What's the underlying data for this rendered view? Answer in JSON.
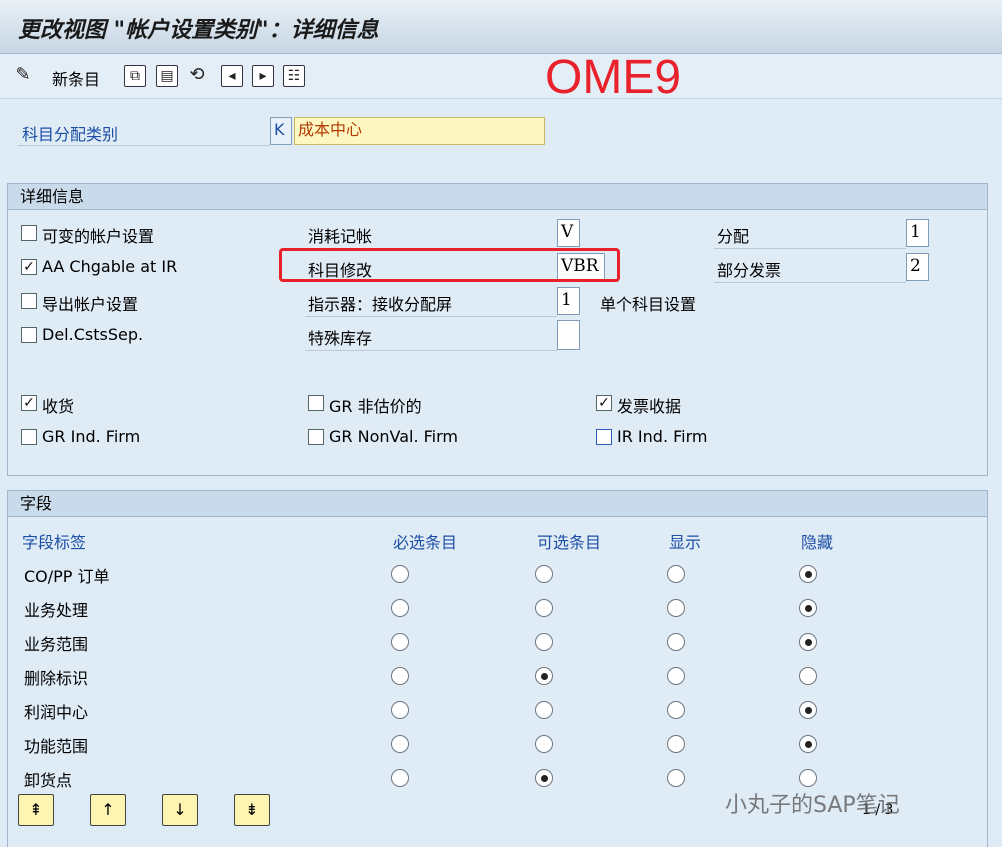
{
  "window": {
    "title": "更改视图 \"帐户设置类别\"：详细信息"
  },
  "toolbar": {
    "new_entries_label": "新条目",
    "icons": [
      "edit-icon",
      "copy-icon",
      "delete-icon",
      "undo-icon",
      "prev-icon",
      "next-icon",
      "select-icon"
    ]
  },
  "annotation": {
    "tcode": "OME9",
    "color": "#e8212a"
  },
  "header": {
    "acct_cat_label": "科目分配类别",
    "acct_cat_code": "K",
    "acct_cat_text": "成本中心"
  },
  "details": {
    "title": "详细信息",
    "left_checks": [
      {
        "label": "可变的帐户设置",
        "checked": false
      },
      {
        "label": "AA Chgable at IR",
        "checked": true
      },
      {
        "label": "导出帐户设置",
        "checked": false
      },
      {
        "label": "Del.CstsSep.",
        "checked": false
      }
    ],
    "mid_fields": [
      {
        "label": "消耗记帐",
        "value": "V"
      },
      {
        "label": "科目修改",
        "value": "VBR"
      },
      {
        "label": "指示器：接收分配屏",
        "value": "1",
        "suffix": "单个科目设置"
      },
      {
        "label": "特殊库存",
        "value": ""
      }
    ],
    "right_fields": [
      {
        "label": "分配",
        "value": "1"
      },
      {
        "label": "部分发票",
        "value": "2"
      }
    ],
    "bottom_checks": [
      {
        "label": "收货",
        "checked": true
      },
      {
        "label": "GR 非估价的",
        "checked": false
      },
      {
        "label": "发票收据",
        "checked": true
      },
      {
        "label": "GR Ind. Firm",
        "checked": false
      },
      {
        "label": "GR NonVal. Firm",
        "checked": false
      },
      {
        "label": "IR Ind. Firm",
        "checked": false
      }
    ]
  },
  "fields_section": {
    "title": "字段",
    "columns": [
      "字段标签",
      "必选条目",
      "可选条目",
      "显示",
      "隐藏"
    ],
    "rows": [
      {
        "label": "CO/PP 订单",
        "selected": 3
      },
      {
        "label": "业务处理",
        "selected": 3
      },
      {
        "label": "业务范围",
        "selected": 3
      },
      {
        "label": "删除标识",
        "selected": 1
      },
      {
        "label": "利润中心",
        "selected": 3
      },
      {
        "label": "功能范围",
        "selected": 3
      },
      {
        "label": "卸货点",
        "selected": 1
      }
    ],
    "page_info": "1 / 3"
  },
  "watermark": "小丸子的SAP笔记"
}
